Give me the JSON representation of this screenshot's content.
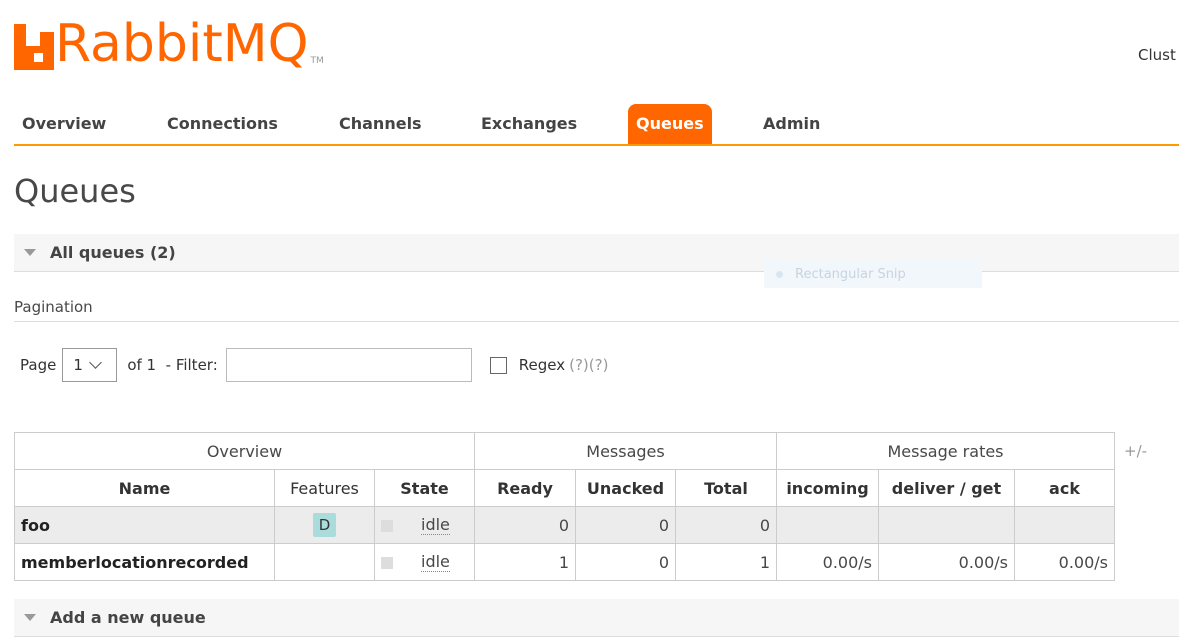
{
  "header": {
    "logo_text": "RabbitMQ",
    "logo_tm": "TM",
    "cluster_label": "Clust"
  },
  "nav": {
    "tabs": [
      {
        "label": "Overview",
        "active": false
      },
      {
        "label": "Connections",
        "active": false
      },
      {
        "label": "Channels",
        "active": false
      },
      {
        "label": "Exchanges",
        "active": false
      },
      {
        "label": "Queues",
        "active": true
      },
      {
        "label": "Admin",
        "active": false
      }
    ]
  },
  "page_title": "Queues",
  "all_queues": {
    "label": "All queues (2)"
  },
  "snip_overlay": {
    "label": "Rectangular Snip"
  },
  "pagination": {
    "title": "Pagination",
    "page_label": "Page",
    "page_value": "1",
    "of_label": "of 1  - Filter:",
    "filter_value": "",
    "regex_label": "Regex",
    "regex_help": "(?)(?)"
  },
  "table": {
    "groups": [
      "Overview",
      "Messages",
      "Message rates"
    ],
    "columns": [
      "Name",
      "Features",
      "State",
      "Ready",
      "Unacked",
      "Total",
      "incoming",
      "deliver / get",
      "ack"
    ],
    "toggle_columns": "+/-",
    "rows": [
      {
        "name": "foo",
        "features": "D",
        "state": "idle",
        "ready": "0",
        "unacked": "0",
        "total": "0",
        "incoming": "",
        "deliver_get": "",
        "ack": ""
      },
      {
        "name": "memberlocationrecorded",
        "features": "",
        "state": "idle",
        "ready": "1",
        "unacked": "0",
        "total": "1",
        "incoming": "0.00/s",
        "deliver_get": "0.00/s",
        "ack": "0.00/s"
      }
    ]
  },
  "add_queue": {
    "label": "Add a new queue"
  },
  "colors": {
    "brand": "#ff6600",
    "nav_underline": "#ff9900"
  }
}
